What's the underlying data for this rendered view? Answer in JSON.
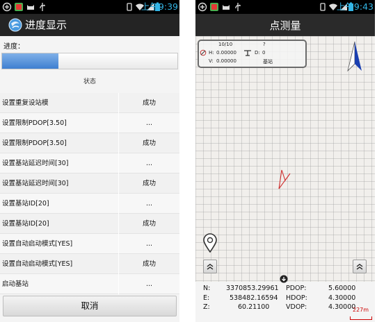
{
  "left": {
    "status_time": "上午9:39",
    "title": "进度显示",
    "progress_label": "进度：",
    "progress_value": 0.32,
    "status_header": "状态",
    "rows": [
      {
        "name": "设置重复设站模",
        "status": "成功"
      },
      {
        "name": "设置限制PDOP[3.50]",
        "status": "..."
      },
      {
        "name": "设置限制PDOP[3.50]",
        "status": "成功"
      },
      {
        "name": "设置基站延迟时间[30]",
        "status": "..."
      },
      {
        "name": "设置基站延迟时间[30]",
        "status": "成功"
      },
      {
        "name": "设置基站ID[20]",
        "status": "..."
      },
      {
        "name": "设置基站ID[20]",
        "status": "成功"
      },
      {
        "name": "设置自动启动模式[YES]",
        "status": "..."
      },
      {
        "name": "设置自动启动模式[YES]",
        "status": "成功"
      },
      {
        "name": "启动基站",
        "status": "..."
      }
    ],
    "cancel_label": "取消"
  },
  "right": {
    "status_time": "上午9:43",
    "title": "点测量",
    "info": {
      "sats": "10/10",
      "unknown": "?",
      "h_label": "H:",
      "h_value": "0.00000",
      "d_label": "D:",
      "d_value": "0",
      "v_label": "V:",
      "v_value": "0.00000",
      "mode": "基站"
    },
    "coords": {
      "n_label": "N:",
      "n_value": "3370853.29961",
      "e_label": "E:",
      "e_value": "538482.16594",
      "z_label": "Z:",
      "z_value": "60.21100",
      "pdop_label": "PDOP:",
      "pdop_value": "5.60000",
      "hdop_label": "HDOP:",
      "hdop_value": "4.30000",
      "vdop_label": "VDOP:",
      "vdop_value": "4.30000"
    },
    "scale": "227m"
  },
  "colors": {
    "status_accent": "#33b5e5",
    "progress_fill": "#3f7fd0",
    "compass_blue": "#1a3fb0",
    "position_red": "#d03030"
  }
}
